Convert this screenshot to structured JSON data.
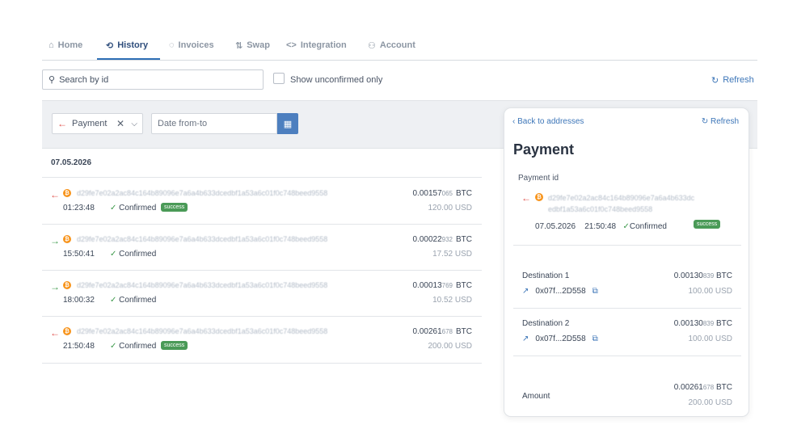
{
  "tabs": [
    {
      "label": "Home",
      "icon": "home-icon",
      "glyph": "⌂"
    },
    {
      "label": "History",
      "icon": "history-icon",
      "glyph": "⟲"
    },
    {
      "label": "Invoices",
      "icon": "invoice-icon",
      "glyph": "◌"
    },
    {
      "label": "Swap",
      "icon": "swap-icon",
      "glyph": "⇅"
    },
    {
      "label": "Integration",
      "icon": "code-icon",
      "glyph": "<>"
    },
    {
      "label": "Account",
      "icon": "user-icon",
      "glyph": "⚇"
    }
  ],
  "search": {
    "placeholder": "Search by id"
  },
  "unconfirmed_label": "Show unconfirmed only",
  "refresh_label": "Refresh",
  "filter": {
    "type": "Payment",
    "date_placeholder": "Date from-to"
  },
  "date_group": "07.05.2026",
  "transactions": [
    {
      "direction": "out",
      "hash": "d29fe7e02a2ac84c164b89096e7a6a4b633dcedbf1a53a6c01f0c748beed9558",
      "time": "01:23:48",
      "status": "Confirmed",
      "badge": "success",
      "btc_main": "0.00157",
      "btc_tail": "065",
      "btc_unit": "BTC",
      "usd": "120.00",
      "usd_unit": "USD"
    },
    {
      "direction": "in",
      "hash": "d29fe7e02a2ac84c164b89096e7a6a4b633dcedbf1a53a6c01f0c748beed9558",
      "time": "15:50:41",
      "status": "Confirmed",
      "badge": "",
      "btc_main": "0.00022",
      "btc_tail": "932",
      "btc_unit": "BTC",
      "usd": "17.52",
      "usd_unit": "USD"
    },
    {
      "direction": "in",
      "hash": "d29fe7e02a2ac84c164b89096e7a6a4b633dcedbf1a53a6c01f0c748beed9558",
      "time": "18:00:32",
      "status": "Confirmed",
      "badge": "",
      "btc_main": "0.00013",
      "btc_tail": "769",
      "btc_unit": "BTC",
      "usd": "10.52",
      "usd_unit": "USD"
    },
    {
      "direction": "out",
      "hash": "d29fe7e02a2ac84c164b89096e7a6a4b633dcedbf1a53a6c01f0c748beed9558",
      "time": "21:50:48",
      "status": "Confirmed",
      "badge": "success",
      "btc_main": "0.00261",
      "btc_tail": "678",
      "btc_unit": "BTC",
      "usd": "200.00",
      "usd_unit": "USD"
    }
  ],
  "detail": {
    "back_label": "Back to addresses",
    "refresh_label": "Refresh",
    "title": "Payment",
    "id_label": "Payment id",
    "hash_line1": "d29fe7e02a2ac84c164b89096e7a6a4b633dc",
    "hash_line2": "edbf1a53a6c01f0c748beed9558",
    "date": "07.05.2026",
    "time": "21:50:48",
    "status": "Confirmed",
    "badge": "success",
    "destinations": [
      {
        "label": "Destination 1",
        "address": "0x07f...2D558",
        "btc_main": "0.00130",
        "btc_tail": "839",
        "btc_unit": "BTC",
        "usd": "100.00",
        "usd_unit": "USD"
      },
      {
        "label": "Destination 2",
        "address": "0x07f...2D558",
        "btc_main": "0.00130",
        "btc_tail": "839",
        "btc_unit": "BTC",
        "usd": "100.00",
        "usd_unit": "USD"
      }
    ],
    "amount": {
      "label": "Amount",
      "btc_main": "0.00261",
      "btc_tail": "678",
      "btc_unit": "BTC",
      "usd": "200.00",
      "usd_unit": "USD"
    }
  },
  "colors": {
    "accent": "#2f6fb5",
    "success": "#4a9a57",
    "outgoing": "#e0504b",
    "incoming": "#3e9a4c",
    "btc": "#f7931a"
  }
}
